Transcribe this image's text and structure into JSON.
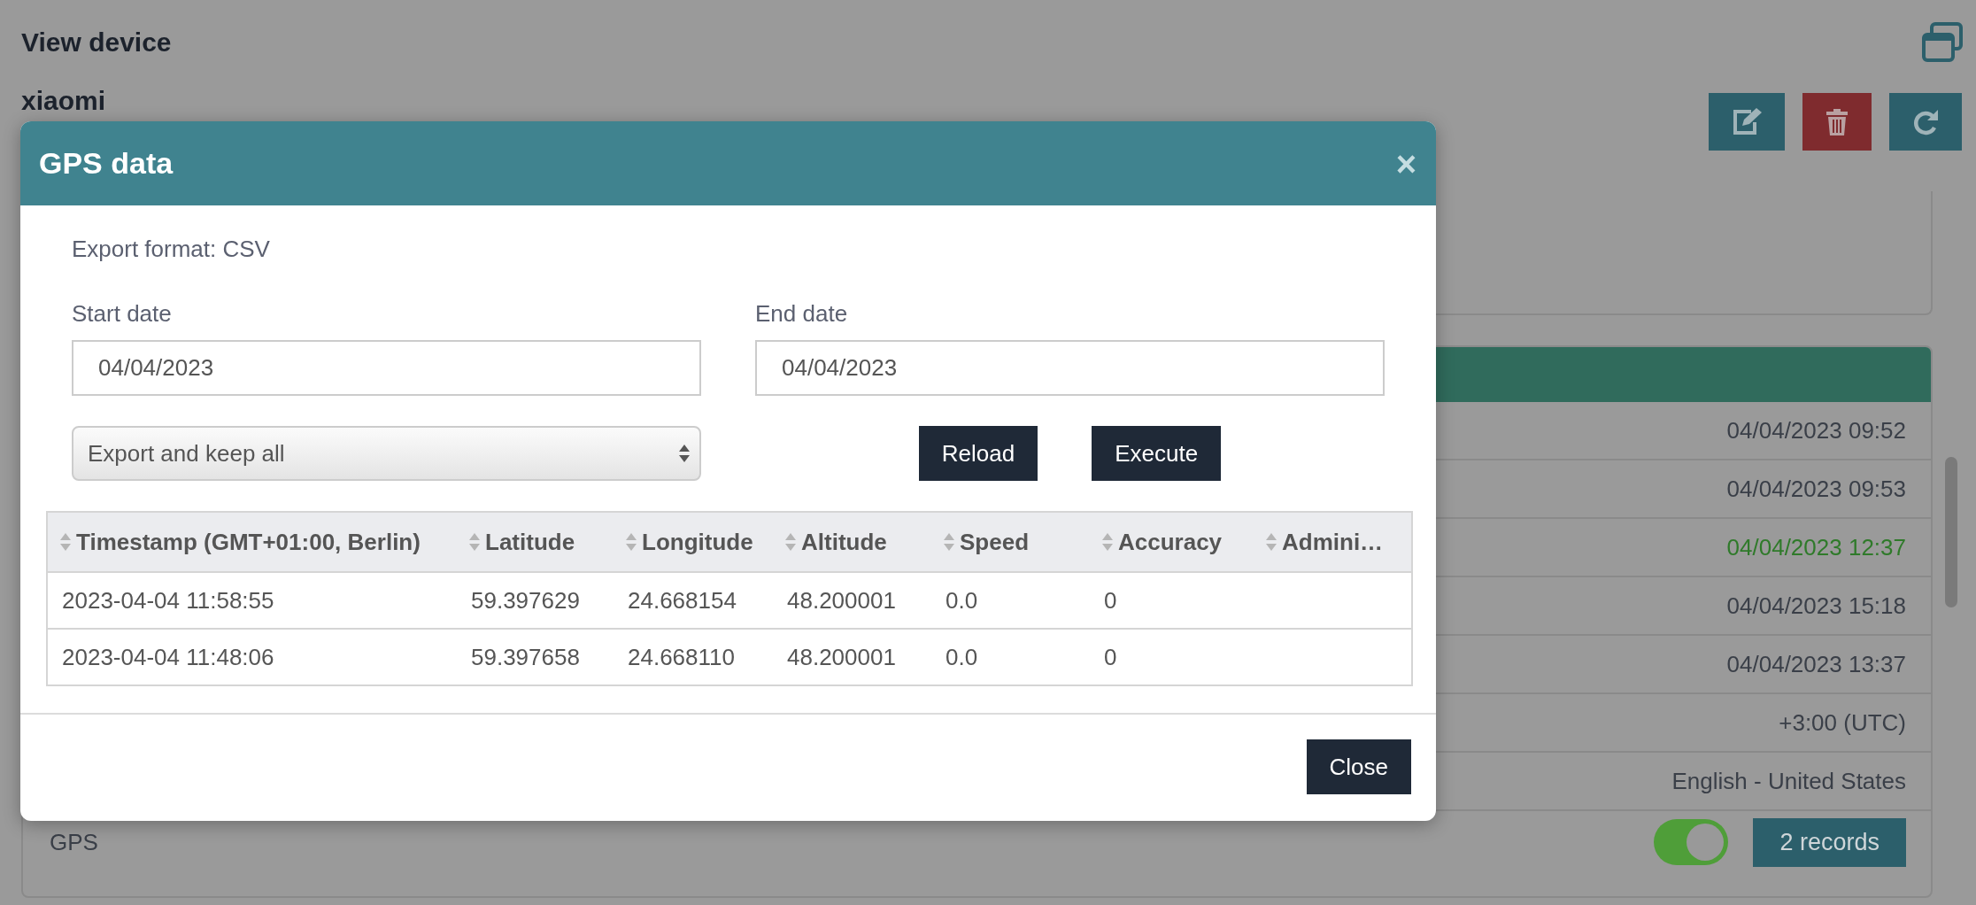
{
  "page": {
    "title": "View device",
    "device_name": "xiaomi",
    "actions": [
      {
        "kind": "edit"
      },
      {
        "kind": "delete"
      },
      {
        "kind": "refresh"
      }
    ]
  },
  "details": {
    "rows": [
      {
        "value": "04/04/2023 09:52",
        "highlighted": false
      },
      {
        "value": "04/04/2023 09:53",
        "highlighted": false
      },
      {
        "value": "04/04/2023 12:37",
        "highlighted": true
      },
      {
        "value": "04/04/2023 15:18",
        "highlighted": false
      },
      {
        "value": "04/04/2023 13:37",
        "highlighted": false
      },
      {
        "value": "+3:00 (UTC)",
        "highlighted": false
      },
      {
        "value": "English - United States",
        "highlighted": false
      }
    ],
    "gps": {
      "label": "GPS",
      "on": true,
      "badge": "2 records"
    }
  },
  "modal": {
    "title": "GPS data",
    "close_glyph": "×",
    "export_format": "Export format: CSV",
    "start_label": "Start date",
    "start_value": "04/04/2023",
    "end_label": "End date",
    "end_value": "04/04/2023",
    "mode": "Export and keep all",
    "buttons": [
      "Reload",
      "Execute"
    ],
    "table": {
      "columns": [
        "Timestamp (GMT+01:00, Berlin)",
        "Latitude",
        "Longitude",
        "Altitude",
        "Speed",
        "Accuracy",
        "Admini…"
      ],
      "rows": [
        [
          "2023-04-04 11:58:55",
          "59.397629",
          "24.668154",
          "48.200001",
          "0.0",
          "0",
          ""
        ],
        [
          "2023-04-04 11:48:06",
          "59.397658",
          "24.668110",
          "48.200001",
          "0.0",
          "0",
          ""
        ]
      ]
    },
    "footer_button": "Close"
  }
}
